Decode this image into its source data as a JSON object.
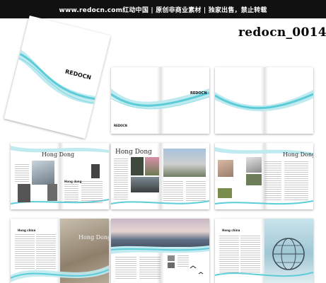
{
  "header": {
    "banner_text": "www.redocn.com红动中国 | 原创非商业素材 | 独家出售，禁止转载"
  },
  "template_code": "redocn_0014",
  "brand": {
    "logo_text": "REDOCN"
  },
  "spreads": {
    "title_hong_dong": "Hong Dong",
    "title_hong_dong_lower": "Hong dong",
    "title_hong_china": "Hong china"
  },
  "colors": {
    "accent_cyan": "#5ccdd8",
    "accent_light": "#bfeaf0",
    "banner_bg": "#111111"
  }
}
